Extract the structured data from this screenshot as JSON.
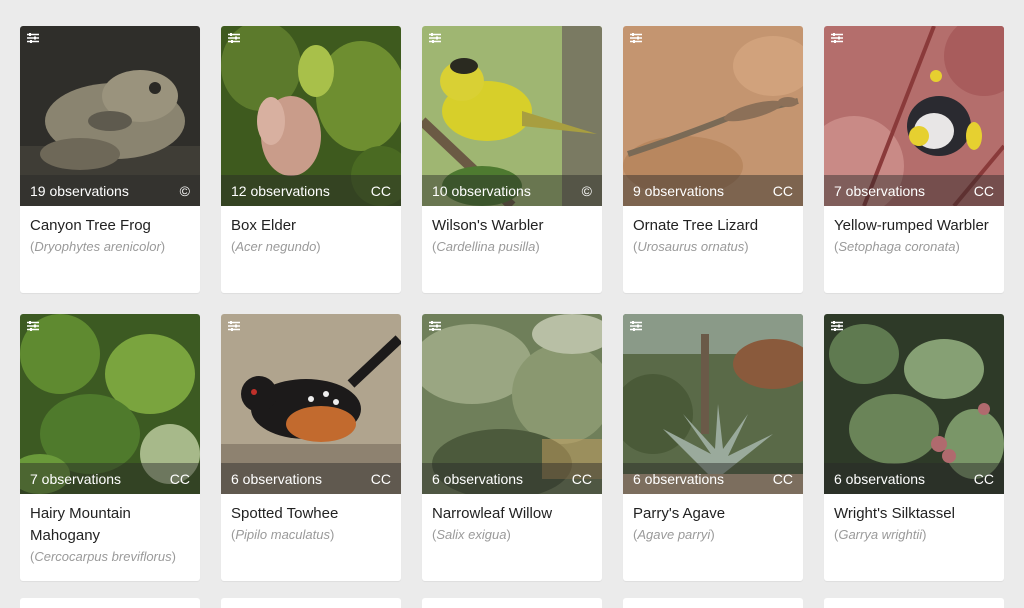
{
  "cards": [
    {
      "common": "Canyon Tree Frog",
      "sci": "Dryophytes arenicolor",
      "obs": "19 observations",
      "license": "©",
      "colors": [
        "#3b3a34",
        "#5e5a4e",
        "#8a8470",
        "#2a2925"
      ]
    },
    {
      "common": "Box Elder",
      "sci": "Acer negundo",
      "obs": "12 observations",
      "license": "CC",
      "colors": [
        "#5c7a2c",
        "#c99c8a",
        "#a8c04a",
        "#3e5a1e"
      ]
    },
    {
      "common": "Wilson's Warbler",
      "sci": "Cardellina pusilla",
      "obs": "10 observations",
      "license": "©",
      "colors": [
        "#8fae5c",
        "#d7cf2a",
        "#7a6e52",
        "#c9cfa2"
      ]
    },
    {
      "common": "Ornate Tree Lizard",
      "sci": "Urosaurus ornatus",
      "obs": "9 observations",
      "license": "CC",
      "colors": [
        "#c1916a",
        "#d3a37c",
        "#8c7058",
        "#b6835c"
      ]
    },
    {
      "common": "Yellow-rumped Warbler",
      "sci": "Setophaga coronata",
      "obs": "7 observations",
      "license": "CC",
      "colors": [
        "#b5706e",
        "#d9a8a0",
        "#2a2a30",
        "#e6d030"
      ]
    },
    {
      "common": "Hairy Mountain Mahogany",
      "sci": "Cercocarpus breviflorus",
      "obs": "7 observations",
      "license": "CC",
      "colors": [
        "#4f7a2c",
        "#7aa43e",
        "#2f4a1c",
        "#a7b98a"
      ]
    },
    {
      "common": "Spotted Towhee",
      "sci": "Pipilo maculatus",
      "obs": "6 observations",
      "license": "CC",
      "colors": [
        "#a89a86",
        "#1c1a1a",
        "#c26a2e",
        "#d8d2c8"
      ]
    },
    {
      "common": "Narrowleaf Willow",
      "sci": "Salix exigua",
      "obs": "6 observations",
      "license": "CC",
      "colors": [
        "#6f7f5a",
        "#9aa682",
        "#4c5a3c",
        "#b8bfa5"
      ]
    },
    {
      "common": "Parry's Agave",
      "sci": "Agave parryi",
      "obs": "6 observations",
      "license": "CC",
      "colors": [
        "#5a6a48",
        "#9aaa9c",
        "#8a5a3c",
        "#c2a88a"
      ]
    },
    {
      "common": "Wright's Silktassel",
      "sci": "Garrya wrightii",
      "obs": "6 observations",
      "license": "CC",
      "colors": [
        "#5f7a50",
        "#86a074",
        "#2e3a28",
        "#b06a6e"
      ]
    }
  ]
}
